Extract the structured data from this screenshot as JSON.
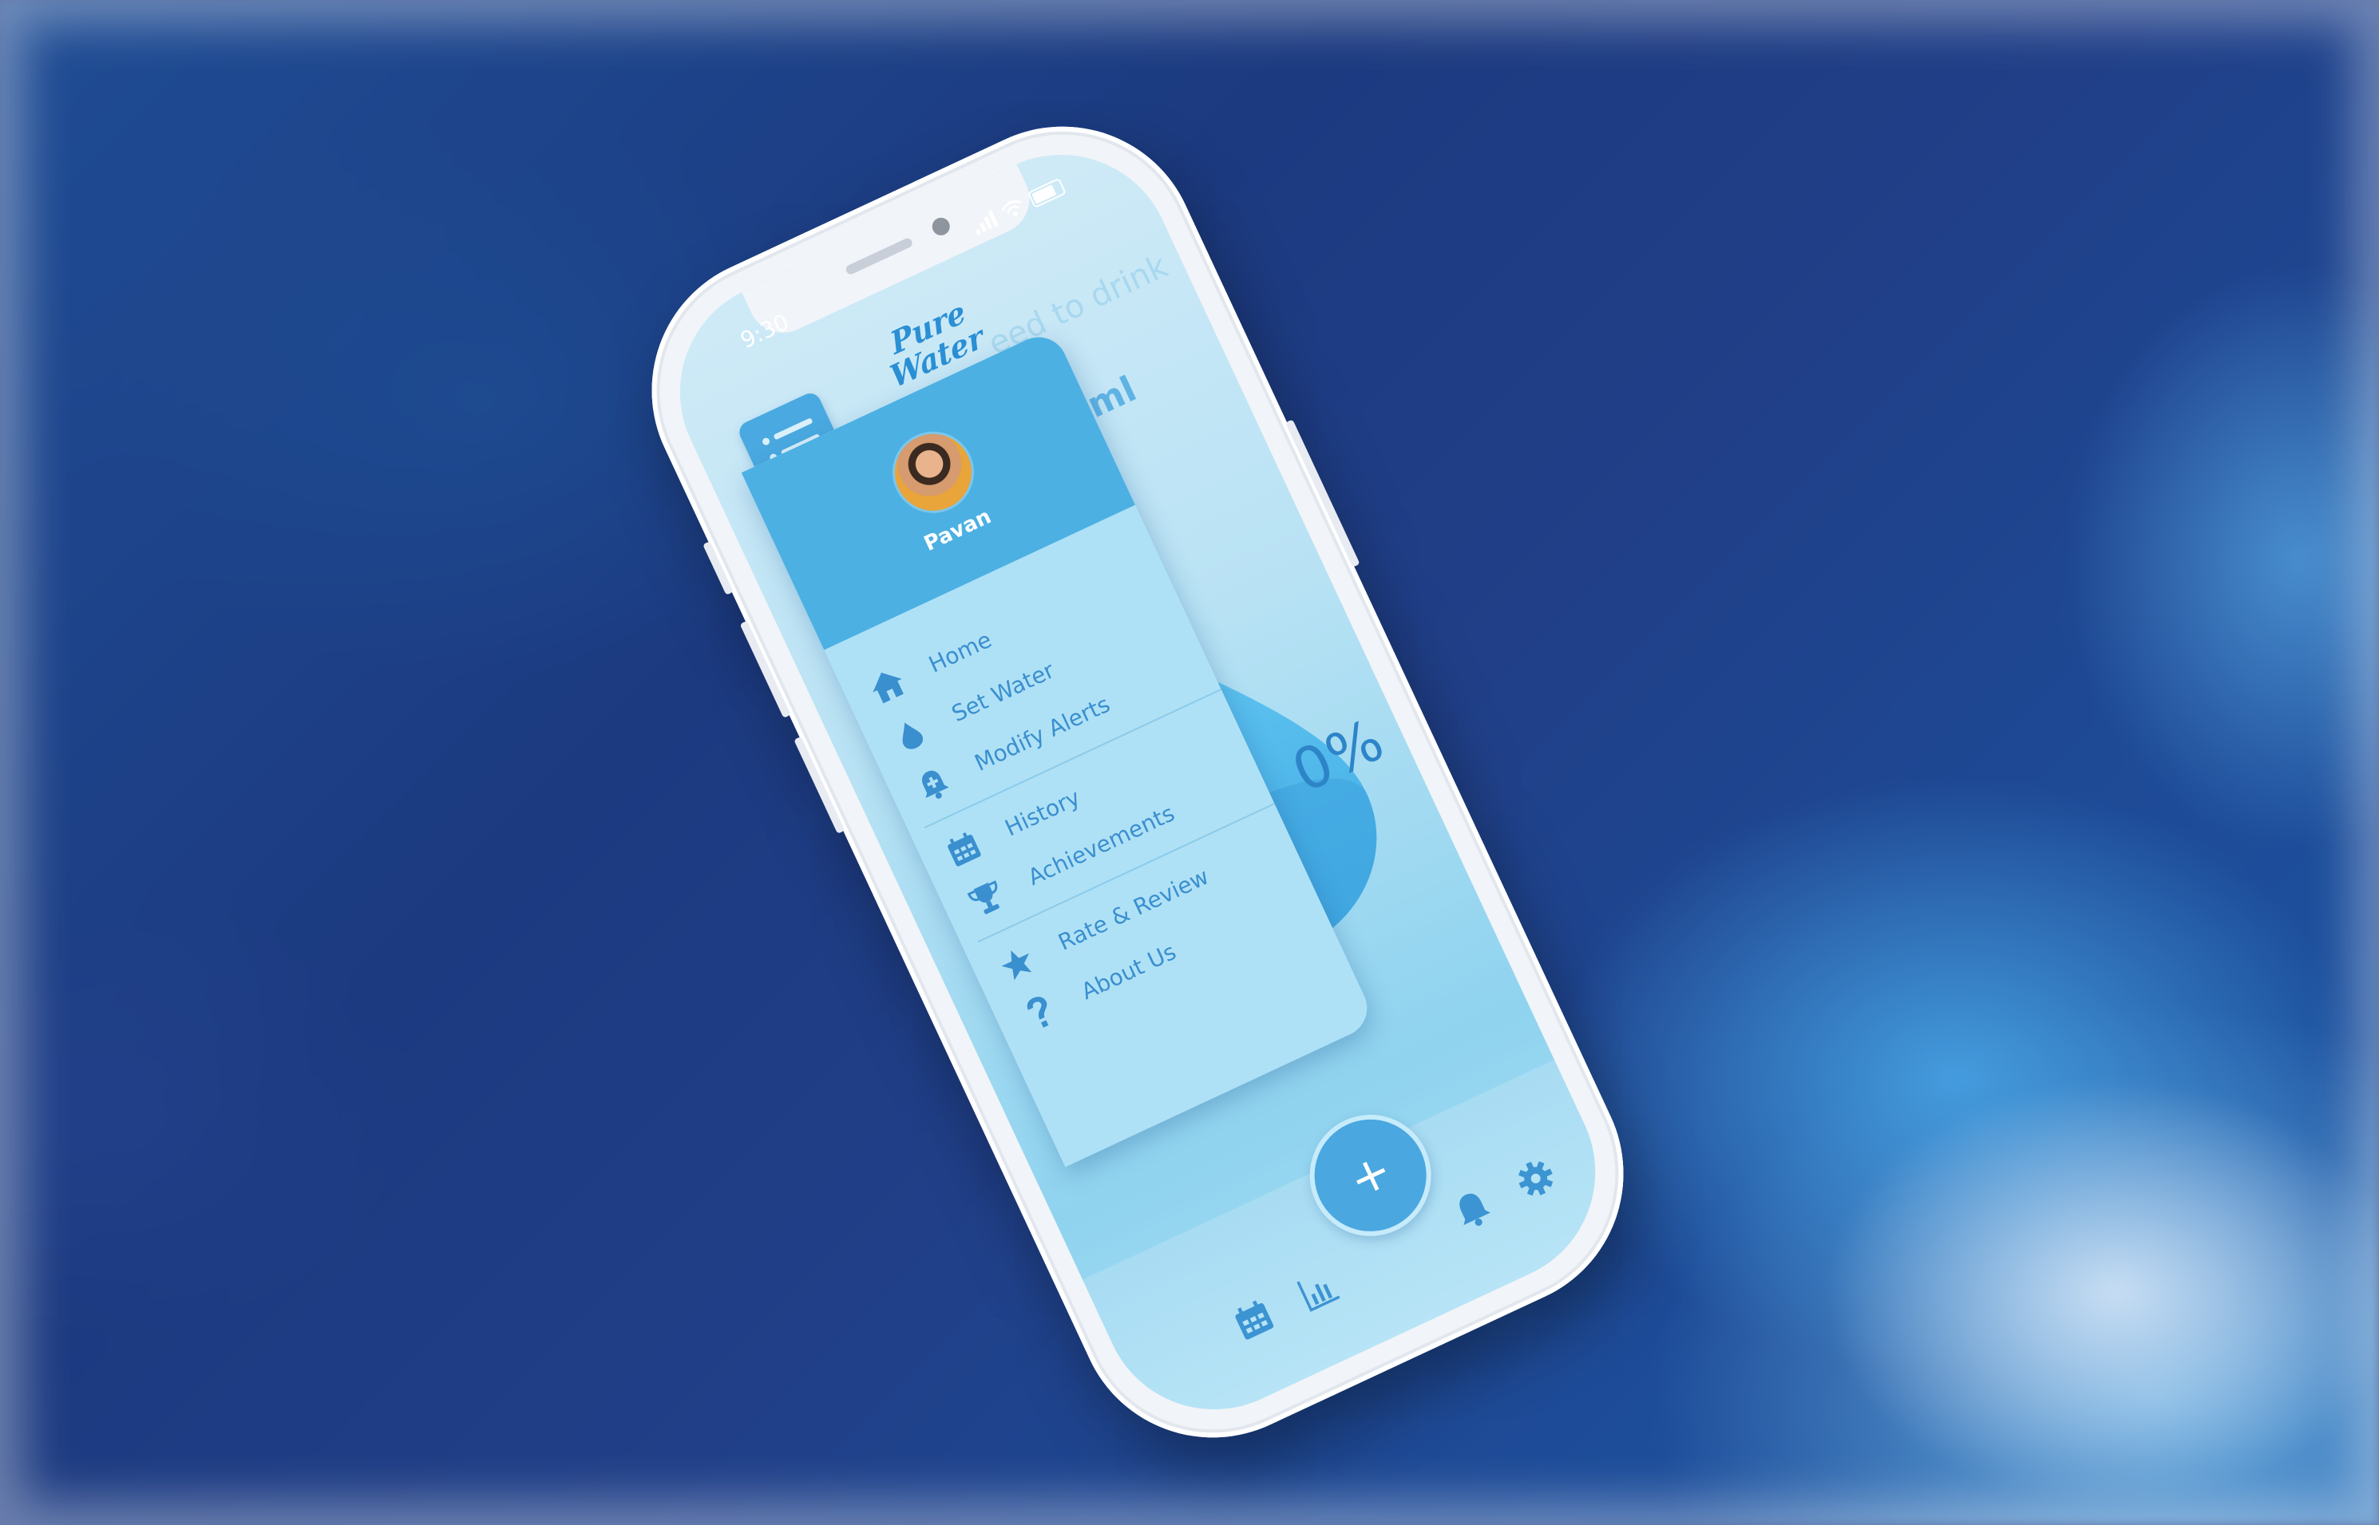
{
  "status": {
    "time": "9:30"
  },
  "app": {
    "title_line1": "Pure",
    "title_line2": "Water"
  },
  "background": {
    "need_to_drink_text": "eed to drink",
    "ml_text": "ml",
    "percent_text": "0%"
  },
  "drawer": {
    "user_name": "Pavan",
    "sections": [
      [
        {
          "label": "Home",
          "icon": "home-icon"
        },
        {
          "label": "Set Water",
          "icon": "water-drop-icon"
        },
        {
          "label": "Modify Alerts",
          "icon": "alert-bell-plus-icon"
        }
      ],
      [
        {
          "label": "History",
          "icon": "calendar-icon"
        },
        {
          "label": "Achievements",
          "icon": "trophy-icon"
        }
      ],
      [
        {
          "label": "Rate & Review",
          "icon": "star-icon"
        },
        {
          "label": "About Us",
          "icon": "question-icon"
        }
      ]
    ]
  },
  "bottom_nav": {
    "add_label": "+",
    "icons": [
      "calendar-icon",
      "chart-icon",
      "bell-icon",
      "settings-icon"
    ]
  },
  "colors": {
    "accent": "#4aa9e0",
    "drawer_bg": "#afe1f6",
    "text_blue": "#3a8fcf"
  }
}
